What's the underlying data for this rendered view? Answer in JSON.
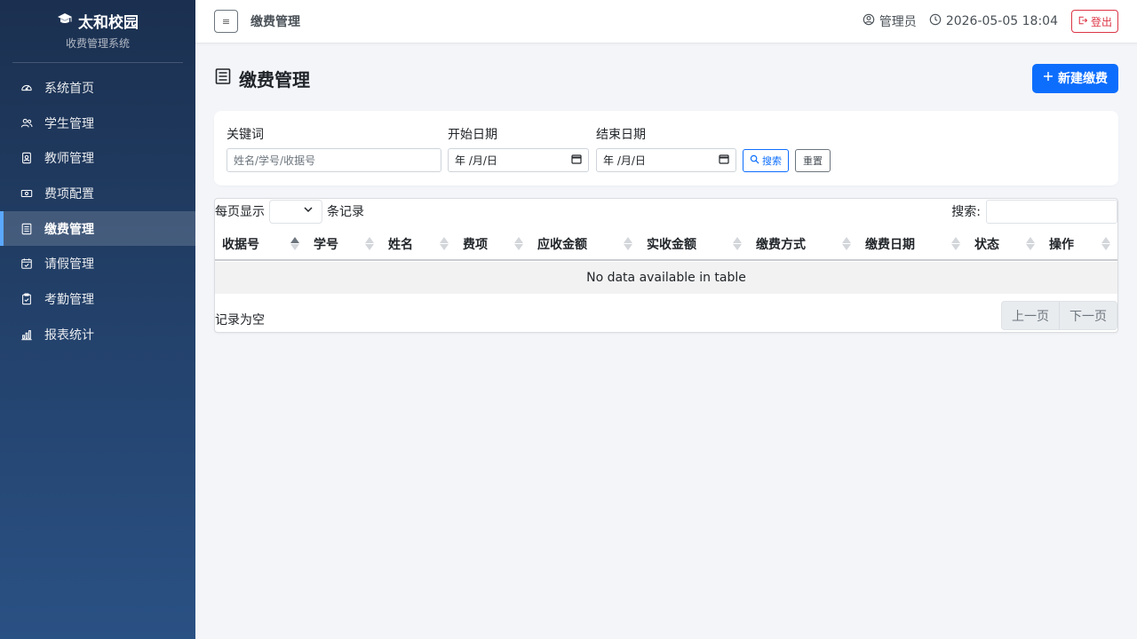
{
  "brand": {
    "name": "太和校园",
    "subtitle": "收费管理系统",
    "icon": "graduation-cap-icon"
  },
  "sidebar": {
    "items": [
      {
        "label": "系统首页",
        "icon": "speedometer-icon",
        "active": false
      },
      {
        "label": "学生管理",
        "icon": "people-icon",
        "active": false
      },
      {
        "label": "教师管理",
        "icon": "person-badge-icon",
        "active": false
      },
      {
        "label": "费项配置",
        "icon": "cash-icon",
        "active": false
      },
      {
        "label": "缴费管理",
        "icon": "receipt-icon",
        "active": true
      },
      {
        "label": "请假管理",
        "icon": "calendar-check-icon",
        "active": false
      },
      {
        "label": "考勤管理",
        "icon": "clipboard-check-icon",
        "active": false
      },
      {
        "label": "报表统计",
        "icon": "bar-chart-icon",
        "active": false
      }
    ]
  },
  "topbar": {
    "toggle_label": "≡",
    "title": "缴费管理",
    "user": "管理员",
    "datetime": "2026-05-05 18:04",
    "logout_label": "登出"
  },
  "page": {
    "title": "缴费管理",
    "new_button_label": "新建缴费"
  },
  "filters": {
    "keyword_label": "关键词",
    "keyword_placeholder": "姓名/学号/收据号",
    "start_label": "开始日期",
    "start_value": "年 /月/日",
    "end_label": "结束日期",
    "end_value": "年 /月/日",
    "search_label": "搜索",
    "reset_label": "重置"
  },
  "table": {
    "length_prefix": "每页显示",
    "length_suffix": "条记录",
    "search_label": "搜索:",
    "columns": [
      "收据号",
      "学号",
      "姓名",
      "费项",
      "应收金额",
      "实收金额",
      "缴费方式",
      "缴费日期",
      "状态",
      "操作"
    ],
    "empty_text": "No data available in table",
    "info": "记录为空",
    "prev_label": "上一页",
    "next_label": "下一页"
  },
  "colors": {
    "primary": "#0d6efd",
    "danger": "#dc3545",
    "sidebar_top": "#1b3050",
    "sidebar_bottom": "#2a5184"
  }
}
